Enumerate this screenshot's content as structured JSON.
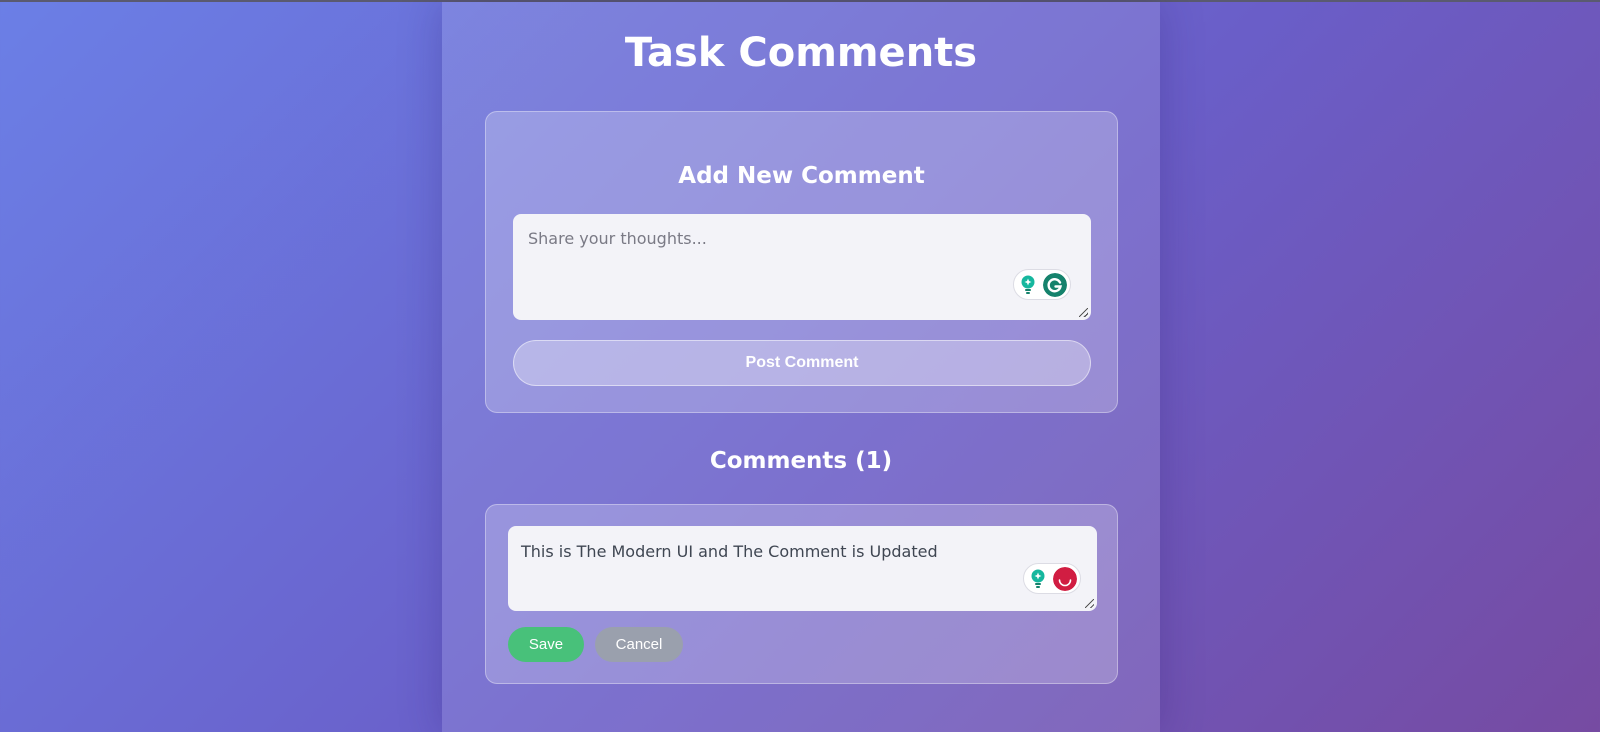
{
  "page": {
    "title": "Task Comments"
  },
  "new_comment": {
    "heading": "Add New Comment",
    "placeholder": "Share your thoughts...",
    "post_label": "Post Comment"
  },
  "comments": {
    "heading": "Comments (1)",
    "items": [
      {
        "edit_text": "This is The Modern UI and The Comment is Updated",
        "save_label": "Save",
        "cancel_label": "Cancel"
      }
    ]
  },
  "icons": {
    "assist": "lightbulb-icon",
    "grammar_active": "grammarly-icon",
    "grammar_issue": "grammarly-alert-icon"
  },
  "colors": {
    "bg_start": "#6b7fe6",
    "bg_end": "#764ba2",
    "save": "#48c17a",
    "cancel": "#9aa0ad",
    "grammarly_green": "#15826c",
    "grammarly_red": "#d11d42"
  }
}
